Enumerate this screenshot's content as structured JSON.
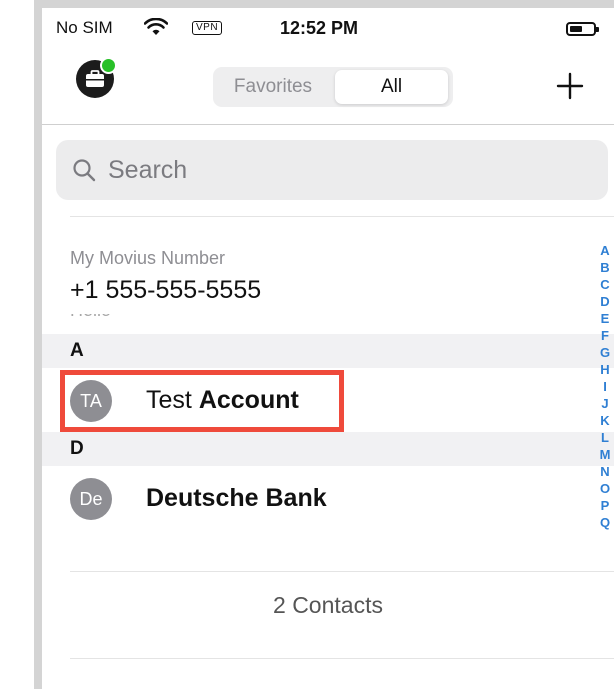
{
  "status_bar": {
    "carrier": "No SIM",
    "vpn": "VPN",
    "time": "12:52 PM"
  },
  "nav": {
    "segments": [
      "Favorites",
      "All"
    ],
    "selected_segment": "All",
    "add_icon": "plus-icon",
    "profile_icon": "briefcase-icon",
    "presence_color": "#28c028"
  },
  "search": {
    "placeholder": "Search"
  },
  "my_number": {
    "label": "My Movius Number",
    "value": "+1 555-555-5555"
  },
  "sections": [
    {
      "letter": "A",
      "contacts": [
        {
          "initials": "TA",
          "first": "Test",
          "last": "Account"
        }
      ]
    },
    {
      "letter": "D",
      "contacts": [
        {
          "initials": "De",
          "first": "",
          "last": "Deutsche Bank"
        }
      ]
    }
  ],
  "footer": {
    "count": "2 Contacts"
  },
  "index_letters": [
    "A",
    "B",
    "C",
    "D",
    "E",
    "F",
    "G",
    "H",
    "I",
    "J",
    "K",
    "L",
    "M",
    "N",
    "O",
    "P",
    "Q"
  ],
  "colors": {
    "accent": "#2f7fd3",
    "highlight": "#ef4a3b",
    "avatar": "#8e8e93"
  }
}
